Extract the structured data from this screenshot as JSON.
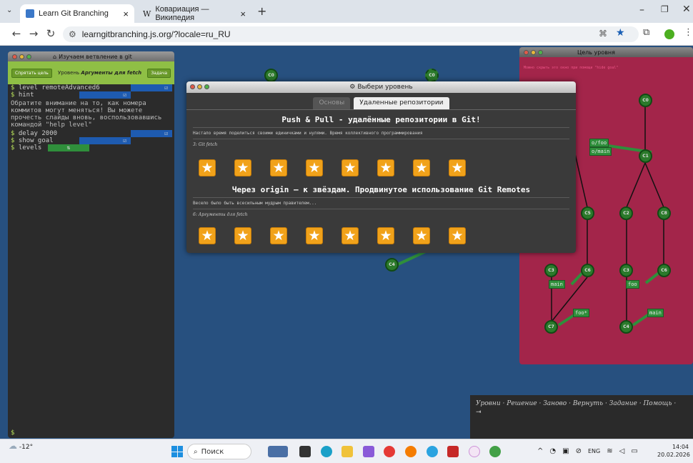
{
  "browser": {
    "tabs": [
      {
        "title": "Learn Git Branching",
        "active": true
      },
      {
        "title": "Ковариация — Википедия",
        "active": false
      }
    ],
    "url": "learngitbranching.js.org/?locale=ru_RU"
  },
  "terminal": {
    "title": "Изучаем ветвление в git",
    "hide_goal_button": "Спрятать цель",
    "level_prefix": "Уровень",
    "level_name": "Аргументы для fetch",
    "task_button": "Задача",
    "commands": [
      "level remoteAdvanced6",
      "hint"
    ],
    "message": "Обратите внимание на то, как номера коммитов могут меняться! Вы можете прочесть слайды вновь, воспользовавшись командой \"help level\"",
    "commands2": [
      "delay 2000",
      "show goal",
      "levels"
    ],
    "prompt": "$",
    "check": "☑",
    "levels_icon": "⇅"
  },
  "goal_panel": {
    "title": "Цель уровня",
    "hint": "Можно скрыть это окно при помощи \"hide goal\"",
    "nodes": [
      "C0",
      "C1",
      "C5",
      "C2",
      "C8",
      "C3",
      "C6",
      "C3",
      "C6",
      "C7",
      "C4"
    ],
    "branches": [
      "o/foo",
      "o/main",
      "main",
      "foo",
      "foo*",
      "main"
    ]
  },
  "stage_nodes": [
    "C0",
    "C0",
    "C4"
  ],
  "modal": {
    "title": "Выбери уровень",
    "tabs": [
      "Основы",
      "Удаленные репозитории"
    ],
    "active_tab": 1,
    "section1": {
      "title": "Push & Pull - удалённые репозитории в Git!",
      "about": "Настало время поделиться своими единичками и нулями. Время коллективного программирования",
      "subtitle": "3: Git fetch",
      "star_count": 8
    },
    "section2": {
      "title": "Через origin – к звёздам. Продвинутое использование Git Remotes",
      "about": "Весело было быть всесильным мудрым правителем...",
      "subtitle": "6: Аргументы для fetch",
      "star_count": 8
    }
  },
  "commands_panel": {
    "items": [
      "Уровни",
      "Решение",
      "Заново",
      "Вернуть",
      "Задание",
      "Помощь"
    ],
    "separator": "·"
  },
  "taskbar": {
    "weather": "-12°",
    "search_placeholder": "Поиск",
    "lang": "ENG",
    "time": "14:04",
    "date": "20.02.2026"
  }
}
